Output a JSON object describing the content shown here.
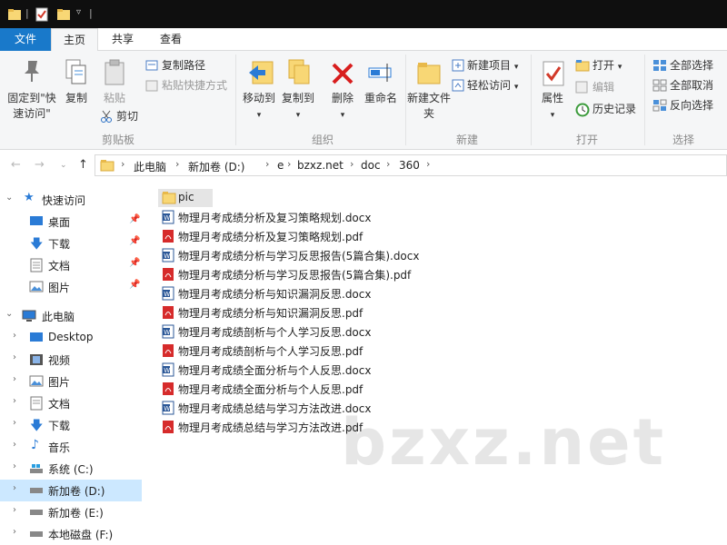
{
  "tabs": {
    "file": "文件",
    "home": "主页",
    "share": "共享",
    "view": "查看"
  },
  "ribbon": {
    "clipboard": {
      "pin": "固定到\"快速访问\"",
      "copy": "复制",
      "paste": "粘贴",
      "copy_path": "复制路径",
      "paste_shortcut": "粘贴快捷方式",
      "cut": "剪切",
      "label": "剪贴板"
    },
    "organize": {
      "move_to": "移动到",
      "copy_to": "复制到",
      "delete": "删除",
      "rename": "重命名",
      "label": "组织"
    },
    "new": {
      "new_folder": "新建文件夹",
      "new_item": "新建项目",
      "easy_access": "轻松访问",
      "label": "新建"
    },
    "open": {
      "properties": "属性",
      "open": "打开",
      "edit": "编辑",
      "history": "历史记录",
      "label": "打开"
    },
    "select": {
      "select_all": "全部选择",
      "select_none": "全部取消",
      "invert": "反向选择",
      "label": "选择"
    }
  },
  "address": {
    "crumbs": [
      "此电脑",
      "新加卷 (D:)",
      "e",
      "bzxz.net",
      "doc",
      "360"
    ]
  },
  "sidebar": {
    "quick_access": "快速访问",
    "quick": [
      {
        "label": "桌面"
      },
      {
        "label": "下载"
      },
      {
        "label": "文档"
      },
      {
        "label": "图片"
      }
    ],
    "this_pc": "此电脑",
    "pc": [
      {
        "label": "Desktop"
      },
      {
        "label": "视频"
      },
      {
        "label": "图片"
      },
      {
        "label": "文档"
      },
      {
        "label": "下载"
      },
      {
        "label": "音乐"
      },
      {
        "label": "系统 (C:)"
      },
      {
        "label": "新加卷 (D:)"
      },
      {
        "label": "新加卷 (E:)"
      },
      {
        "label": "本地磁盘 (F:)"
      }
    ]
  },
  "files": [
    {
      "name": "pic",
      "type": "folder"
    },
    {
      "name": "物理月考成绩分析及复习策略规划.docx",
      "type": "docx"
    },
    {
      "name": "物理月考成绩分析及复习策略规划.pdf",
      "type": "pdf"
    },
    {
      "name": "物理月考成绩分析与学习反思报告(5篇合集).docx",
      "type": "docx"
    },
    {
      "name": "物理月考成绩分析与学习反思报告(5篇合集).pdf",
      "type": "pdf"
    },
    {
      "name": "物理月考成绩分析与知识漏洞反思.docx",
      "type": "docx"
    },
    {
      "name": "物理月考成绩分析与知识漏洞反思.pdf",
      "type": "pdf"
    },
    {
      "name": "物理月考成绩剖析与个人学习反思.docx",
      "type": "docx"
    },
    {
      "name": "物理月考成绩剖析与个人学习反思.pdf",
      "type": "pdf"
    },
    {
      "name": "物理月考成绩全面分析与个人反思.docx",
      "type": "docx"
    },
    {
      "name": "物理月考成绩全面分析与个人反思.pdf",
      "type": "pdf"
    },
    {
      "name": "物理月考成绩总结与学习方法改进.docx",
      "type": "docx"
    },
    {
      "name": "物理月考成绩总结与学习方法改进.pdf",
      "type": "pdf"
    }
  ],
  "watermark": "bzxz.net"
}
